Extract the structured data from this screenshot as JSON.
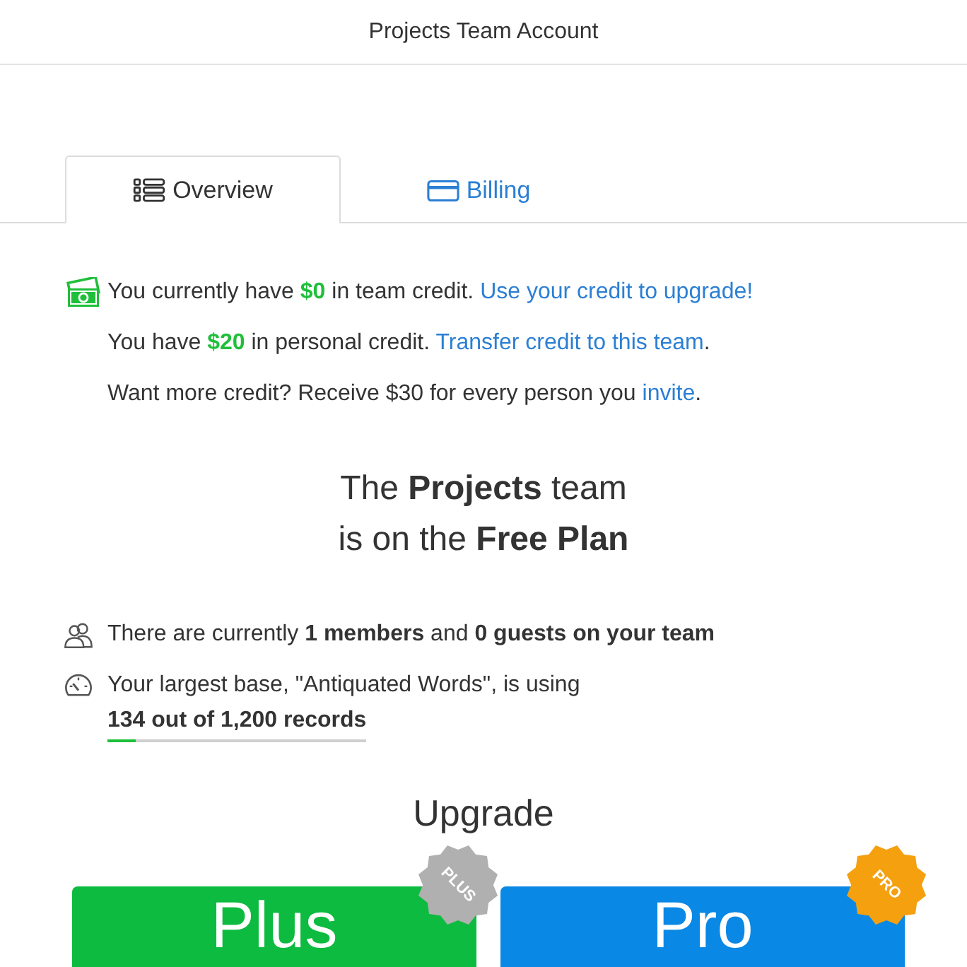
{
  "header": {
    "title": "Projects Team Account"
  },
  "tabs": [
    {
      "label": "Overview",
      "selected": true
    },
    {
      "label": "Billing",
      "selected": false
    }
  ],
  "credit_lines": [
    {
      "text": "You currently have **$0** in team credit.",
      "link": "Use your credit to upgrade!"
    },
    {
      "text": "You have **$20** in personal credit.",
      "link": "Transfer credit to this team",
      "tail": "."
    },
    {
      "text": "Want more credit? Receive $30 for every person you",
      "link": "invite",
      "tail": "."
    }
  ],
  "plan_heading": [
    "The **Projects** team",
    "is on the **Free Plan**"
  ],
  "stats": [
    {
      "text": "There are currently **1 members** and **0 guests on your team**"
    },
    {
      "text": "Your largest base, \"Antiquated Words\", is using",
      "usage": {
        "text": "134 out of 1,200 records",
        "level": 0.11
      }
    }
  ],
  "upgrade": {
    "title": "Upgrade",
    "plans": [
      {
        "name": "Plus",
        "color": "#0cbb3f",
        "badge": {
          "text": "PLUS",
          "color": "#b0b0b0"
        }
      },
      {
        "name": "Pro",
        "color": "#0a88e6",
        "badge": {
          "text": "PRO",
          "color": "#f5a00f"
        }
      }
    ]
  }
}
